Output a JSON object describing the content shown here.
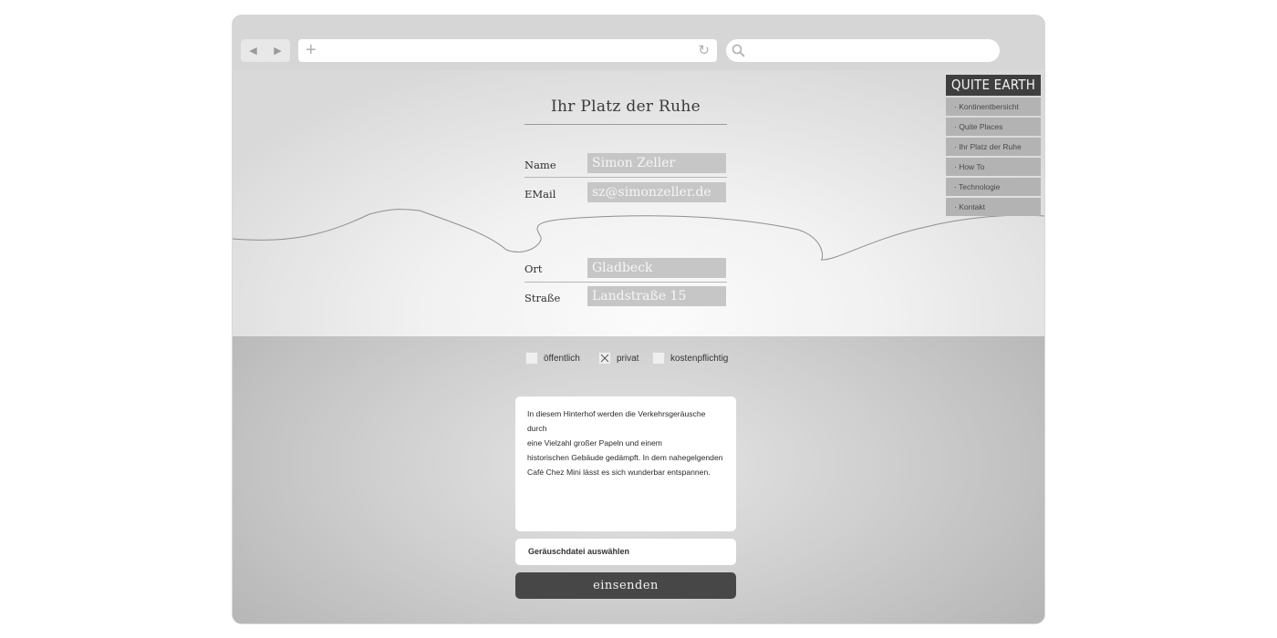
{
  "browser": {
    "back_icon": "◀",
    "forward_icon": "▶",
    "new_tab_icon": "+",
    "reload_icon": "↻"
  },
  "site": {
    "brand": "QUITE EARTH",
    "menu": [
      {
        "label": "· Kontinentbersicht"
      },
      {
        "label": "· Quite Places"
      },
      {
        "label": "· Ihr Platz der Ruhe"
      },
      {
        "label": "· How To"
      },
      {
        "label": "· Technologie"
      },
      {
        "label": "· Kontakt"
      }
    ]
  },
  "form": {
    "title": "Ihr Platz der Ruhe",
    "name_label": "Name",
    "name_value": "Simon Zeller",
    "email_label": "EMail",
    "email_value": "sz@simonzeller.de",
    "ort_label": "Ort",
    "ort_value": "Gladbeck",
    "strasse_label": "Straße",
    "strasse_value": "Landstraße 15",
    "options": [
      {
        "label": "öffentlich",
        "checked": false
      },
      {
        "label": "privat",
        "checked": true
      },
      {
        "label": "kostenpflichtig",
        "checked": false
      }
    ],
    "description_lines": [
      "In diesem Hinterhof werden die Verkehrsgeräusche durch",
      "eine Vielzahl großer Papeln und einem",
      "historischen Gebäude gedämpft. In dem nahegelgenden",
      "Café Chez Mini lässt es sich wunderbar entspannen."
    ],
    "file_button": "Geräuschdatei auswählen",
    "submit": "einsenden"
  },
  "colors": {
    "brand_bg": "#3f3f3f",
    "submit_bg": "#474747",
    "field_bg": "#c6c6c6"
  }
}
